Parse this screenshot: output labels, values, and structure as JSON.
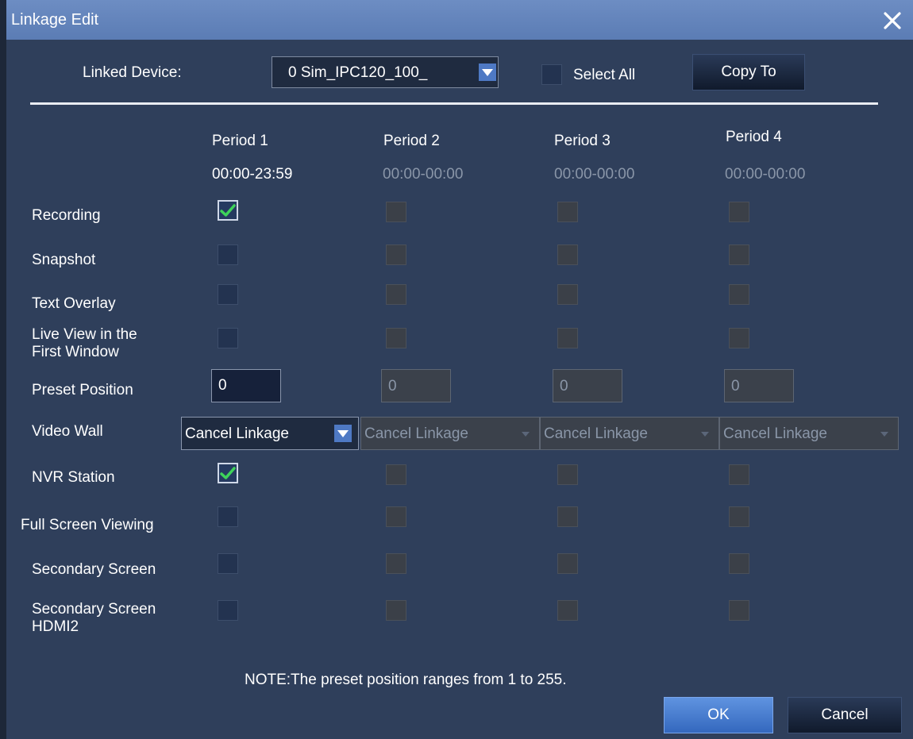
{
  "window": {
    "title": "Linkage Edit"
  },
  "top": {
    "linked_device_label": "Linked Device:",
    "linked_device_value": "0 Sim_IPC120_100_",
    "select_all_label": "Select All",
    "copy_to_label": "Copy To"
  },
  "periods": [
    {
      "name": "Period 1",
      "time": "00:00-23:59"
    },
    {
      "name": "Period 2",
      "time": "00:00-00:00"
    },
    {
      "name": "Period 3",
      "time": "00:00-00:00"
    },
    {
      "name": "Period 4",
      "time": "00:00-00:00"
    }
  ],
  "rows": {
    "recording": "Recording",
    "snapshot": "Snapshot",
    "text_overlay": "Text Overlay",
    "live_view_line1": "Live View in the",
    "live_view_line2": "First Window",
    "preset_position": "Preset Position",
    "video_wall": "Video Wall",
    "nvr_station": "NVR Station",
    "full_screen": "Full Screen Viewing",
    "secondary_screen": "Secondary Screen",
    "secondary_hdmi2_line1": "Secondary Screen",
    "secondary_hdmi2_line2": "HDMI2"
  },
  "preset_values": [
    "0",
    "0",
    "0",
    "0"
  ],
  "video_wall_values": [
    "Cancel Linkage",
    "Cancel Linkage",
    "Cancel Linkage",
    "Cancel Linkage"
  ],
  "checked": {
    "recording_p1": true,
    "nvr_station_p1": true
  },
  "note": "NOTE:The preset position ranges from 1 to 255.",
  "buttons": {
    "ok": "OK",
    "cancel": "Cancel"
  },
  "colors": {
    "background": "#2f3f5b",
    "titlebar": "#6584bb",
    "accent": "#4e79c4",
    "check": "#3ed35a"
  }
}
